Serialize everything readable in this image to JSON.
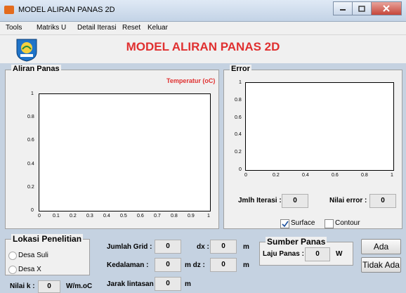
{
  "window": {
    "title": "MODEL ALIRAN PANAS 2D"
  },
  "menu": [
    "Tools",
    "Matriks U",
    "Detail Iterasi",
    "Reset",
    "Keluar"
  ],
  "header": {
    "title": "MODEL ALIRAN PANAS 2D"
  },
  "aliran": {
    "title": "Aliran Panas",
    "plot_label": "Temperatur (oC)",
    "y_ticks": [
      "1",
      "0.8",
      "0.6",
      "0.4",
      "0.2",
      "0"
    ],
    "x_ticks": [
      "0",
      "0.1",
      "0.2",
      "0.3",
      "0.4",
      "0.5",
      "0.6",
      "0.7",
      "0.8",
      "0.9",
      "1"
    ]
  },
  "error": {
    "title": "Error",
    "y_ticks": [
      "1",
      "0.8",
      "0.6",
      "0.4",
      "0.2",
      "0"
    ],
    "x_ticks": [
      "0",
      "0.2",
      "0.4",
      "0.6",
      "0.8",
      "1"
    ],
    "jmlh_iterasi_label": "Jmlh Iterasi :",
    "jmlh_iterasi_value": "0",
    "nilai_error_label": "Nilai error :",
    "nilai_error_value": "0",
    "surface_label": "Surface",
    "contour_label": "Contour"
  },
  "lokasi": {
    "title": "Lokasi Penelitian",
    "options": [
      "Desa Suli",
      "Desa X"
    ]
  },
  "grid": {
    "jumlah_grid_label": "Jumlah Grid  :",
    "jumlah_grid_value": "0",
    "dx_label": "dx :",
    "dx_value": "0",
    "m1": "m",
    "kedalaman_label": "Kedalaman   :",
    "kedalaman_value": "0",
    "dz_label": "m  dz :",
    "dz_value": "0",
    "m2": "m",
    "jarak_label": "Jarak lintasan :",
    "jarak_value": "0",
    "m3": "m"
  },
  "nilai_k": {
    "label": "Nilai k :",
    "value": "0",
    "unit": "W/m.oC"
  },
  "sumber": {
    "title": "Sumber Panas",
    "laju_label": "Laju Panas :",
    "laju_value": "0",
    "unit": "W"
  },
  "buttons": {
    "ada": "Ada",
    "tidak_ada": "Tidak Ada"
  }
}
